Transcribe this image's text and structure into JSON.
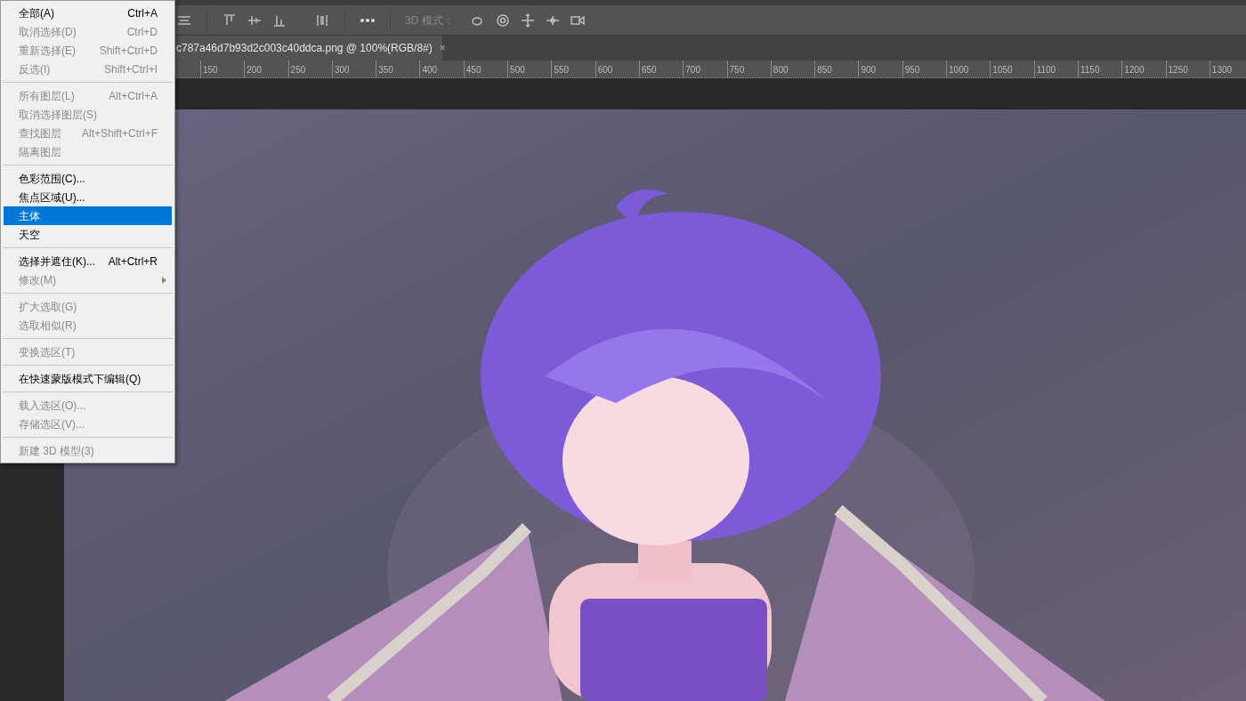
{
  "toolbar": {
    "mode_label": "3D 模式："
  },
  "document_tab": {
    "title": "c787a46d7b93d2c003c40ddca.png @ 100%(RGB/8#)",
    "close": "×",
    "selected": true
  },
  "ruler": {
    "labels": [
      "150",
      "200",
      "250",
      "300",
      "350",
      "400",
      "450",
      "500",
      "550",
      "600",
      "650",
      "700",
      "750",
      "800",
      "850",
      "900",
      "950",
      "1000",
      "1050",
      "1100",
      "1150",
      "1200",
      "1250",
      "1300"
    ]
  },
  "menu": {
    "items": [
      {
        "kind": "item",
        "label": "全部(A)",
        "shortcut": "Ctrl+A",
        "disabled": false,
        "selected": false
      },
      {
        "kind": "item",
        "label": "取消选择(D)",
        "shortcut": "Ctrl+D",
        "disabled": true,
        "selected": false
      },
      {
        "kind": "item",
        "label": "重新选择(E)",
        "shortcut": "Shift+Ctrl+D",
        "disabled": true,
        "selected": false
      },
      {
        "kind": "item",
        "label": "反选(I)",
        "shortcut": "Shift+Ctrl+I",
        "disabled": true,
        "selected": false
      },
      {
        "kind": "separator"
      },
      {
        "kind": "item",
        "label": "所有图层(L)",
        "shortcut": "Alt+Ctrl+A",
        "disabled": true,
        "selected": false
      },
      {
        "kind": "item",
        "label": "取消选择图层(S)",
        "disabled": true,
        "selected": false
      },
      {
        "kind": "item",
        "label": "查找图层",
        "shortcut": "Alt+Shift+Ctrl+F",
        "disabled": true,
        "selected": false
      },
      {
        "kind": "item",
        "label": "隔离图层",
        "disabled": true,
        "selected": false
      },
      {
        "kind": "separator"
      },
      {
        "kind": "item",
        "label": "色彩范围(C)...",
        "disabled": false,
        "selected": false
      },
      {
        "kind": "item",
        "label": "焦点区域(U)...",
        "disabled": false,
        "selected": false
      },
      {
        "kind": "item",
        "label": "主体",
        "disabled": false,
        "selected": true
      },
      {
        "kind": "item",
        "label": "天空",
        "disabled": false,
        "selected": false
      },
      {
        "kind": "separator"
      },
      {
        "kind": "item",
        "label": "选择并遮住(K)...",
        "shortcut": "Alt+Ctrl+R",
        "disabled": false,
        "selected": false
      },
      {
        "kind": "item",
        "label": "修改(M)",
        "disabled": true,
        "selected": false,
        "submenu": true
      },
      {
        "kind": "separator"
      },
      {
        "kind": "item",
        "label": "扩大选取(G)",
        "disabled": true,
        "selected": false
      },
      {
        "kind": "item",
        "label": "选取相似(R)",
        "disabled": true,
        "selected": false
      },
      {
        "kind": "separator"
      },
      {
        "kind": "item",
        "label": "变换选区(T)",
        "disabled": true,
        "selected": false
      },
      {
        "kind": "separator"
      },
      {
        "kind": "item",
        "label": "在快速蒙版模式下编辑(Q)",
        "disabled": false,
        "selected": false
      },
      {
        "kind": "separator"
      },
      {
        "kind": "item",
        "label": "载入选区(O)...",
        "disabled": true,
        "selected": false
      },
      {
        "kind": "item",
        "label": "存储选区(V)...",
        "disabled": true,
        "selected": false
      },
      {
        "kind": "separator"
      },
      {
        "kind": "item",
        "label": "新建 3D 模型(3)",
        "disabled": true,
        "selected": false
      }
    ]
  }
}
